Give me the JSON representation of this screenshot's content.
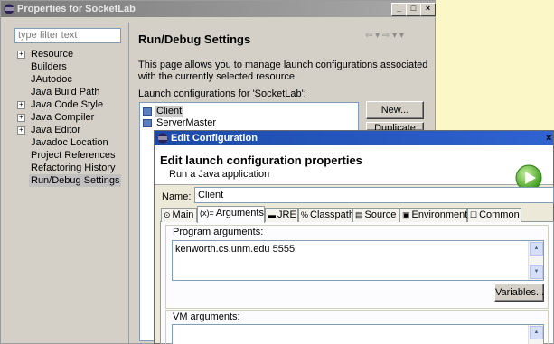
{
  "properties_window": {
    "title": "Properties for SocketLab",
    "caption_buttons": [
      "_",
      "□",
      "×"
    ],
    "filter_placeholder": "type filter text",
    "tree": [
      {
        "label": "Resource",
        "expandable": true
      },
      {
        "label": "Builders",
        "expandable": false
      },
      {
        "label": "JAutodoc",
        "expandable": false
      },
      {
        "label": "Java Build Path",
        "expandable": false
      },
      {
        "label": "Java Code Style",
        "expandable": true
      },
      {
        "label": "Java Compiler",
        "expandable": true
      },
      {
        "label": "Java Editor",
        "expandable": true
      },
      {
        "label": "Javadoc Location",
        "expandable": false
      },
      {
        "label": "Project References",
        "expandable": false
      },
      {
        "label": "Refactoring History",
        "expandable": false
      },
      {
        "label": "Run/Debug Settings",
        "expandable": false,
        "selected": true
      }
    ],
    "page_title": "Run/Debug Settings",
    "nav_arrows": "⇦ ▾ ⇨ ▾ ▾",
    "description": "This page allows you to manage launch configurations associated with the currently selected resource.",
    "launch_label": "Launch configurations for 'SocketLab':",
    "configurations": [
      {
        "label": "Client",
        "selected": true
      },
      {
        "label": "ServerMaster",
        "selected": false
      }
    ],
    "new_button": "New...",
    "duplicate_button": "Duplicate"
  },
  "edit_dialog": {
    "title": "Edit Configuration",
    "close": "×",
    "header_title": "Edit launch configuration properties",
    "header_subtitle": "Run a Java application",
    "name_label": "Name:",
    "name_value": "Client",
    "tabs": [
      {
        "label": "Main",
        "icon": "main-tab-icon",
        "glyph": "⊙"
      },
      {
        "label": "Arguments",
        "icon": "arguments-tab-icon",
        "glyph": "(x)=",
        "active": true
      },
      {
        "label": "JRE",
        "icon": "jre-tab-icon",
        "glyph": "▬"
      },
      {
        "label": "Classpath",
        "icon": "classpath-tab-icon",
        "glyph": "%"
      },
      {
        "label": "Source",
        "icon": "source-tab-icon",
        "glyph": "▤"
      },
      {
        "label": "Environment",
        "icon": "environment-tab-icon",
        "glyph": "▣"
      },
      {
        "label": "Common",
        "icon": "common-tab-icon",
        "glyph": "☐"
      }
    ],
    "program_args_label": "Program arguments:",
    "program_args_value": "kenworth.cs.unm.edu 5555",
    "variables_button": "Variables...",
    "vm_args_label": "VM arguments:",
    "vm_args_value": ""
  }
}
